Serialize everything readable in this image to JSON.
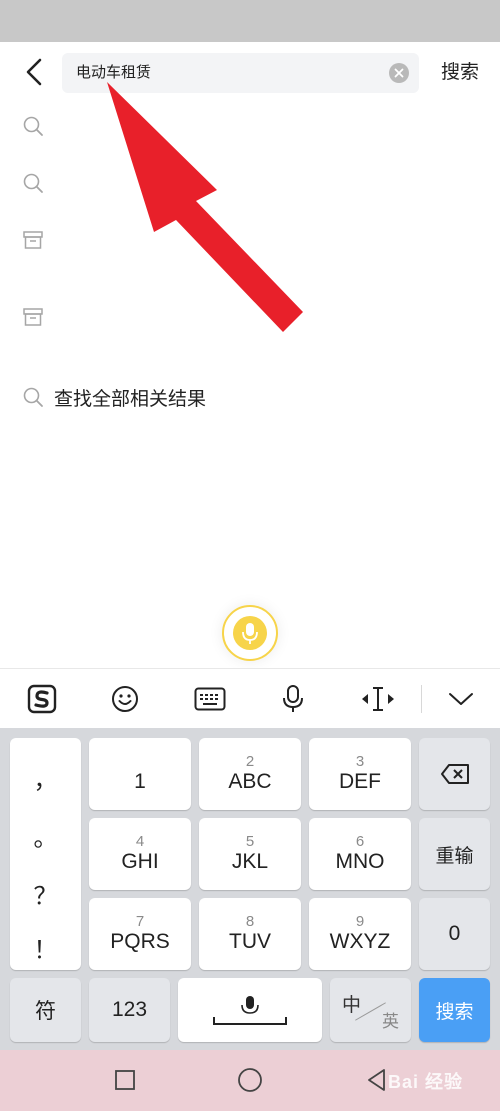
{
  "search": {
    "query": "电动车租赁",
    "submit_label": "搜索"
  },
  "suggestions": {
    "find_all_label": "查找全部相关结果",
    "icons": [
      "search-icon",
      "search-icon",
      "archive-icon",
      "archive-icon"
    ]
  },
  "keyboard": {
    "toolbar_icons": [
      "sogou-logo-icon",
      "emoji-icon",
      "keyboard-icon",
      "microphone-icon",
      "cursor-move-icon",
      "collapse-chevron-icon"
    ],
    "punctuation": [
      "，",
      "。",
      "？",
      "！"
    ],
    "keys": [
      {
        "num": "",
        "label": "1"
      },
      {
        "num": "2",
        "label": "ABC"
      },
      {
        "num": "3",
        "label": "DEF"
      },
      {
        "num": "4",
        "label": "GHI"
      },
      {
        "num": "5",
        "label": "JKL"
      },
      {
        "num": "6",
        "label": "MNO"
      },
      {
        "num": "7",
        "label": "PQRS"
      },
      {
        "num": "8",
        "label": "TUV"
      },
      {
        "num": "9",
        "label": "WXYZ"
      }
    ],
    "reinput_label": "重输",
    "zero_label": "0",
    "symbol_label": "符",
    "numbers_label": "123",
    "lang_zh": "中",
    "lang_en": "英",
    "enter_label": "搜索",
    "accent_color": "#4a9ff5"
  },
  "navigation": {
    "icons": [
      "recent-apps-icon",
      "home-icon",
      "back-triangle-icon"
    ]
  },
  "annotation": {
    "arrow_color": "#e8202a"
  },
  "watermark": {
    "text": "Bai 经验"
  }
}
